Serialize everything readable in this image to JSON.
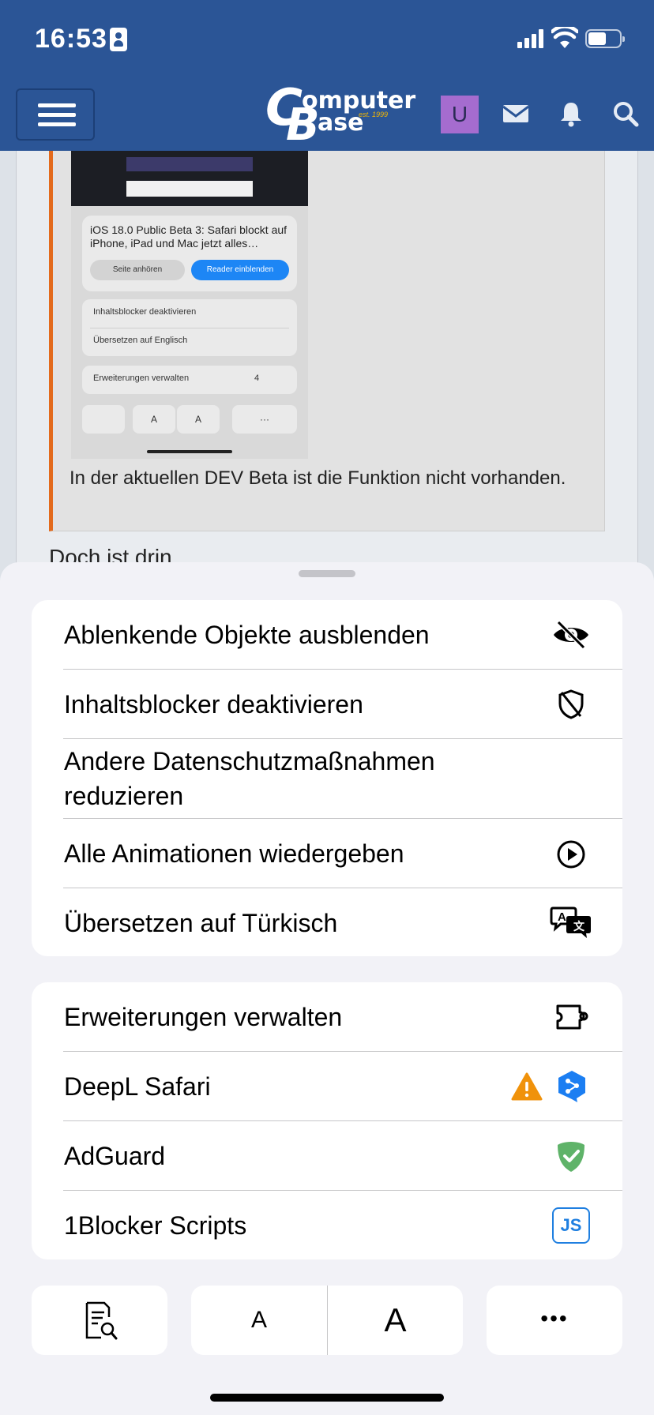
{
  "status_bar": {
    "time": "16:53"
  },
  "header": {
    "brand": {
      "c": "C",
      "omputer": "omputer",
      "b": "B",
      "ase": "ase",
      "est": "est. 1999"
    },
    "avatar_letter": "U",
    "colors": {
      "bar": "#2b5596",
      "avatar": "#a56ccf"
    }
  },
  "background": {
    "screenshot": {
      "title": "iOS 18.0 Public Beta 3: Safari blockt auf iPhone, iPad und Mac jetzt alles…",
      "listen_pill": "Seite anhören",
      "reader_pill": "Reader einblenden",
      "row1": "Inhaltsblocker deaktivieren",
      "row2": "Übersetzen auf Englisch",
      "extensions": "Erweiterungen verwalten",
      "ext_count": "4",
      "small_a": "A",
      "large_a": "A",
      "more": "···"
    },
    "quote_text": "In der aktuellen DEV Beta ist die Funktion nicht vorhanden.",
    "following_text": "Doch ist drin"
  },
  "sheet": {
    "group1": [
      {
        "label": "Ablenkende Objekte ausblenden",
        "icon": "eye-slash-icon"
      },
      {
        "label": "Inhaltsblocker deaktivieren",
        "icon": "shield-slash-icon"
      },
      {
        "label": "Andere Datenschutzmaßnahmen reduzieren",
        "icon": ""
      },
      {
        "label": "Alle Animationen wiedergeben",
        "icon": "play-circle-icon"
      },
      {
        "label": "Übersetzen auf Türkisch",
        "icon": "translate-icon"
      }
    ],
    "group2": [
      {
        "label": "Erweiterungen verwalten",
        "icon": "puzzle-icon"
      },
      {
        "label": "DeepL Safari",
        "icon": "deepl-icon",
        "warning_icon": "warning-icon"
      },
      {
        "label": "AdGuard",
        "icon": "adguard-shield-icon"
      },
      {
        "label": "1Blocker Scripts",
        "icon": "js-icon",
        "icon_text": "JS"
      }
    ],
    "toolbar": {
      "reader_icon": "page-search-icon",
      "small_font": "A",
      "large_font": "A",
      "more": "•••"
    },
    "colors": {
      "warning": "#f0920b",
      "deepl": "#1b7ef2",
      "adguard": "#5fb369",
      "js": "#1f7fe0"
    }
  }
}
